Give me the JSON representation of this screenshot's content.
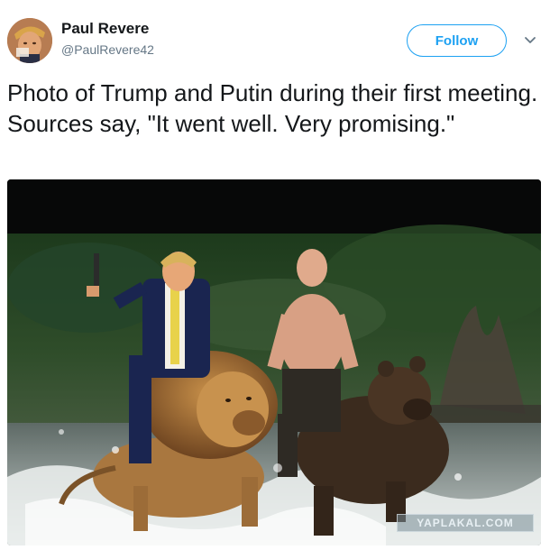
{
  "tweet": {
    "author": {
      "display_name": "Paul Revere",
      "handle": "@PaulRevere42"
    },
    "follow_label": "Follow",
    "text": "Photo of Trump and Putin during their first meeting. Sources say, \"It went well. Very promising.\"",
    "media": {
      "watermark": "YAPLAKAL.COM"
    }
  },
  "icons": {
    "menu": "chevron-down-icon",
    "avatar": "avatar"
  },
  "colors": {
    "accent": "#1da1f2",
    "text": "#14171a",
    "secondary_text": "#657786"
  }
}
